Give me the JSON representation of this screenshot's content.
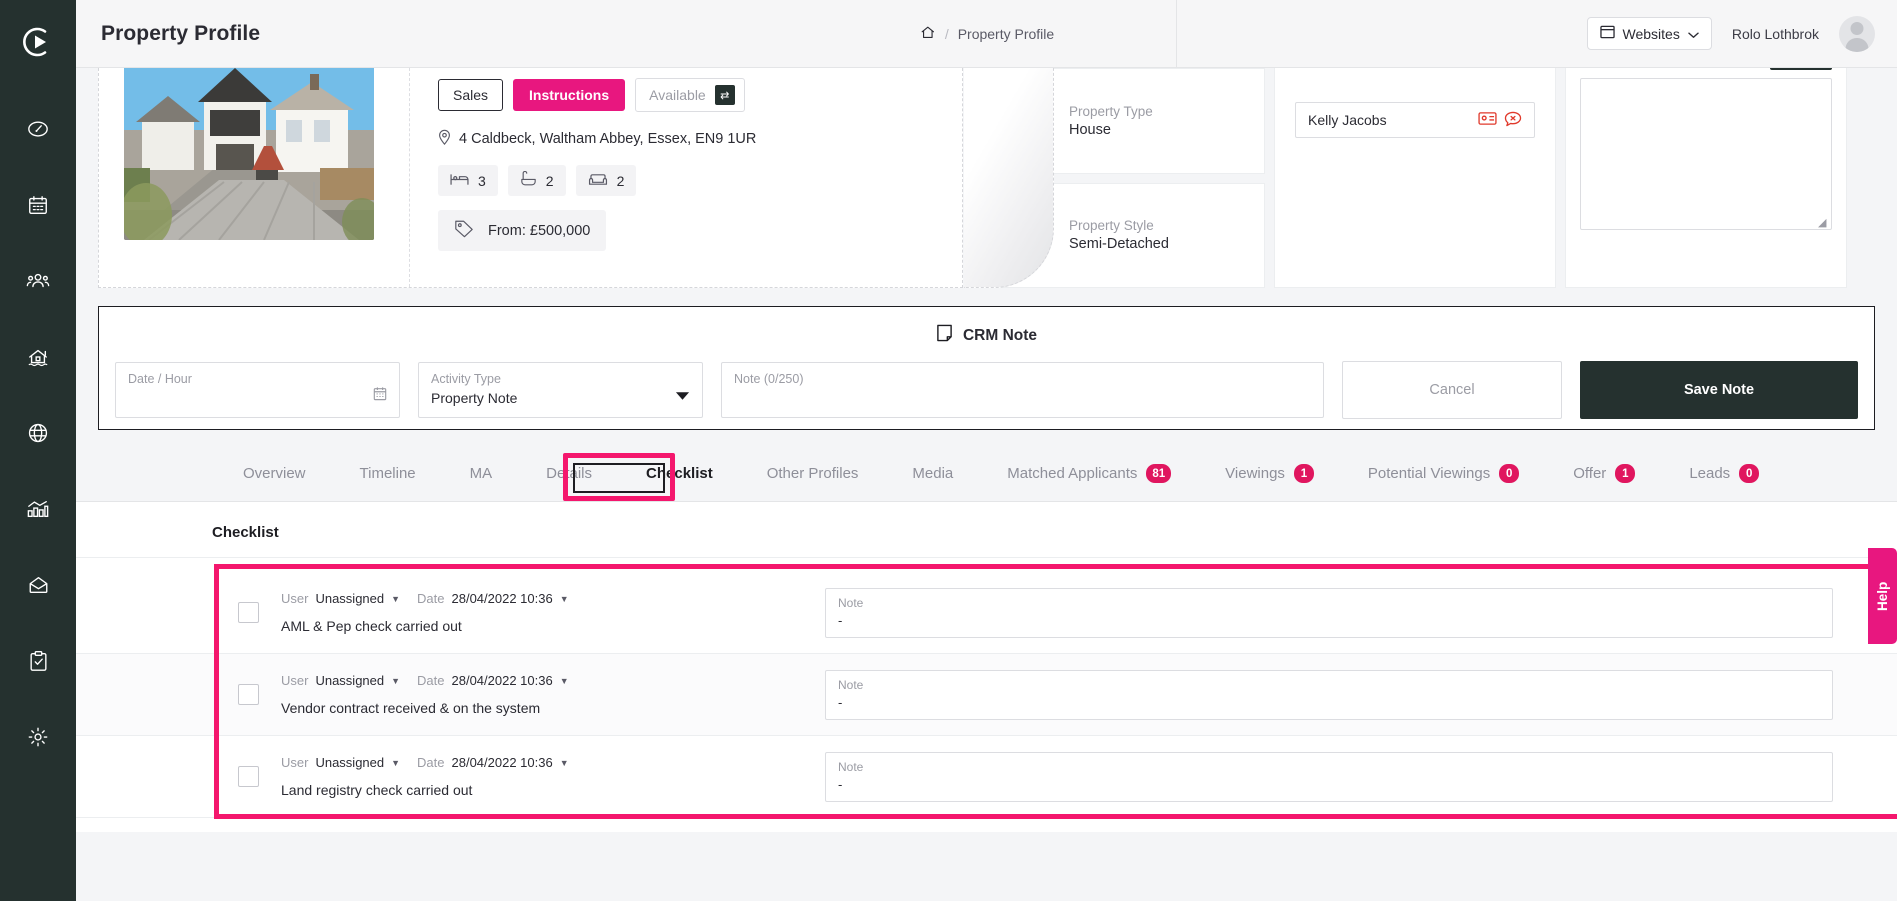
{
  "header": {
    "page_title": "Property Profile",
    "breadcrumb": {
      "home_icon": "home-icon",
      "separator": "/",
      "current": "Property Profile"
    },
    "websites_label": "Websites",
    "websites_icon": "window-icon",
    "chevron_icon": "chevron-down-icon",
    "user_name": "Rolo Lothbrok",
    "avatar_icon": "avatar-icon"
  },
  "sidebar": {
    "logo_icon": "play-circle-logo",
    "items": [
      {
        "icon": "dashboard-speedometer-icon",
        "name": "dashboard"
      },
      {
        "icon": "calendar-icon",
        "name": "calendar"
      },
      {
        "icon": "people-group-icon",
        "name": "contacts"
      },
      {
        "icon": "house-icon",
        "name": "properties"
      },
      {
        "icon": "globe-icon",
        "name": "web"
      },
      {
        "icon": "bar-chart-icon",
        "name": "reports"
      },
      {
        "icon": "envelope-open-icon",
        "name": "messages"
      },
      {
        "icon": "clipboard-check-icon",
        "name": "tasks"
      },
      {
        "icon": "gear-icon",
        "name": "settings"
      }
    ]
  },
  "summary": {
    "sales_label": "Sales",
    "instructions_label": "Instructions",
    "available_label": "Available",
    "swap_icon": "swap-arrows-icon",
    "pin_icon": "map-pin-icon",
    "address": "4 Caldbeck, Waltham Abbey, Essex, EN9 1UR",
    "features": [
      {
        "icon": "bed-icon",
        "value": "3"
      },
      {
        "icon": "bath-icon",
        "value": "2"
      },
      {
        "icon": "sofa-icon",
        "value": "2"
      }
    ],
    "price_icon": "tag-icon",
    "price": "From: £500,000"
  },
  "info_cards": [
    {
      "icon": "house-icon",
      "label": "Property Type",
      "value": "House"
    },
    {
      "icon": "house-icon",
      "label": "Property Style",
      "value": "Semi-Detached"
    }
  ],
  "vendor": {
    "name": "Kelly Jacobs",
    "icons": [
      "address-card-icon",
      "comment-x-icon"
    ]
  },
  "diary": {
    "resize_icon": "resize-handle-icon"
  },
  "crm": {
    "title": "CRM Note",
    "title_icon": "note-page-icon",
    "date_label": "Date / Hour",
    "date_value": "",
    "date_icon": "calendar-icon",
    "activity_label": "Activity Type",
    "activity_value": "Property Note",
    "activity_icon": "caret-down-icon",
    "note_label": "Note (0/250)",
    "note_value": "",
    "cancel_label": "Cancel",
    "save_label": "Save Note"
  },
  "tabs": [
    {
      "label": "Overview",
      "badge": null,
      "active": false
    },
    {
      "label": "Timeline",
      "badge": null,
      "active": false
    },
    {
      "label": "MA",
      "badge": null,
      "active": false
    },
    {
      "label": "Details",
      "badge": null,
      "active": false
    },
    {
      "label": "Checklist",
      "badge": null,
      "active": true
    },
    {
      "label": "Other Profiles",
      "badge": null,
      "active": false
    },
    {
      "label": "Media",
      "badge": null,
      "active": false
    },
    {
      "label": "Matched Applicants",
      "badge": "81",
      "active": false
    },
    {
      "label": "Viewings",
      "badge": "1",
      "active": false
    },
    {
      "label": "Potential Viewings",
      "badge": "0",
      "active": false
    },
    {
      "label": "Offer",
      "badge": "1",
      "active": false
    },
    {
      "label": "Leads",
      "badge": "0",
      "active": false
    }
  ],
  "checklist": {
    "heading": "Checklist",
    "user_key": "User",
    "date_key": "Date",
    "note_label": "Note",
    "rows": [
      {
        "user": "Unassigned",
        "date": "28/04/2022 10:36",
        "task": "AML & Pep check carried out",
        "note": "-",
        "checked": false
      },
      {
        "user": "Unassigned",
        "date": "28/04/2022 10:36",
        "task": "Vendor contract received & on the system",
        "note": "-",
        "checked": false
      },
      {
        "user": "Unassigned",
        "date": "28/04/2022 10:36",
        "task": "Land registry check carried out",
        "note": "-",
        "checked": false
      }
    ]
  },
  "help": {
    "label": "Help"
  },
  "colors": {
    "accent_pink": "#e8177f",
    "badge_pink": "#e0165f",
    "highlight_pink": "#f4176d",
    "sidebar_dark": "#25312f"
  }
}
